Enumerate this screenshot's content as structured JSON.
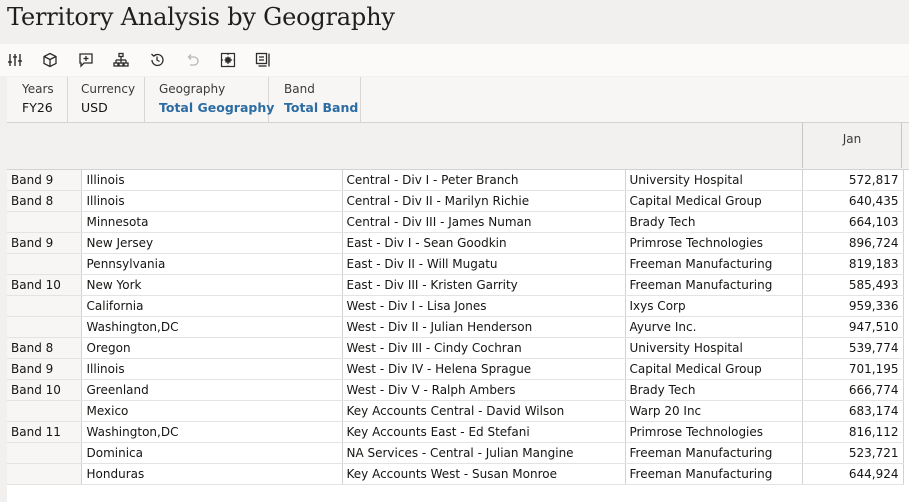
{
  "page_title": "Territory Analysis by Geography",
  "toolbar": {
    "icons": [
      "sliders-icon",
      "cube-icon",
      "add-comment-icon",
      "hierarchy-icon",
      "history-icon",
      "undo-icon",
      "grid-select-icon",
      "panel-icon"
    ]
  },
  "pov": {
    "years": {
      "label": "Years",
      "value": "FY26"
    },
    "currency": {
      "label": "Currency",
      "value": "USD"
    },
    "geography": {
      "label": "Geography",
      "value": "Total Geography"
    },
    "band": {
      "label": "Band",
      "value": "Total Band"
    }
  },
  "grid": {
    "column_header": "Jan",
    "rows": [
      {
        "band": "Band 9",
        "state": "Illinois",
        "division": "Central -  Div I - Peter Branch",
        "account": "University Hospital",
        "jan": "572,817"
      },
      {
        "band": "Band 8",
        "state": "Illinois",
        "division": "Central -  Div II - Marilyn Richie",
        "account": "Capital Medical Group",
        "jan": "640,435"
      },
      {
        "band": "",
        "state": "Minnesota",
        "division": "Central -  Div III - James Numan",
        "account": "Brady Tech",
        "jan": "664,103"
      },
      {
        "band": "Band 9",
        "state": "New Jersey",
        "division": "East -  Div I - Sean Goodkin",
        "account": "Primrose Technologies",
        "jan": "896,724"
      },
      {
        "band": "",
        "state": "Pennsylvania",
        "division": "East -  Div II - Will Mugatu",
        "account": "Freeman Manufacturing",
        "jan": "819,183"
      },
      {
        "band": "Band 10",
        "state": "New York",
        "division": "East -  Div III - Kristen Garrity",
        "account": "Freeman Manufacturing",
        "jan": "585,493"
      },
      {
        "band": "",
        "state": "California",
        "division": "West -  Div I - Lisa Jones",
        "account": "Ixys Corp",
        "jan": "959,336"
      },
      {
        "band": "",
        "state": "Washington,DC",
        "division": "West -  Div II - Julian Henderson",
        "account": "Ayurve Inc.",
        "jan": "947,510"
      },
      {
        "band": "Band 8",
        "state": "Oregon",
        "division": "West -  Div III - Cindy Cochran",
        "account": "University Hospital",
        "jan": "539,774"
      },
      {
        "band": "Band 9",
        "state": "Illinois",
        "division": "West -  Div IV - Helena Sprague",
        "account": "Capital Medical Group",
        "jan": "701,195"
      },
      {
        "band": "Band 10",
        "state": "Greenland",
        "division": "West -  Div V - Ralph Ambers",
        "account": "Brady Tech",
        "jan": "666,774"
      },
      {
        "band": "",
        "state": "Mexico",
        "division": "Key Accounts Central - David Wilson",
        "account": "Warp 20 Inc",
        "jan": "683,174"
      },
      {
        "band": "Band 11",
        "state": "Washington,DC",
        "division": "Key Accounts East - Ed Stefani",
        "account": "Primrose Technologies",
        "jan": "816,112"
      },
      {
        "band": "",
        "state": "Dominica",
        "division": "NA Services - Central - Julian Mangine",
        "account": "Freeman Manufacturing",
        "jan": "523,721"
      },
      {
        "band": "",
        "state": "Honduras",
        "division": "Key Accounts West - Susan Monroe",
        "account": "Freeman Manufacturing",
        "jan": "644,924"
      }
    ]
  }
}
